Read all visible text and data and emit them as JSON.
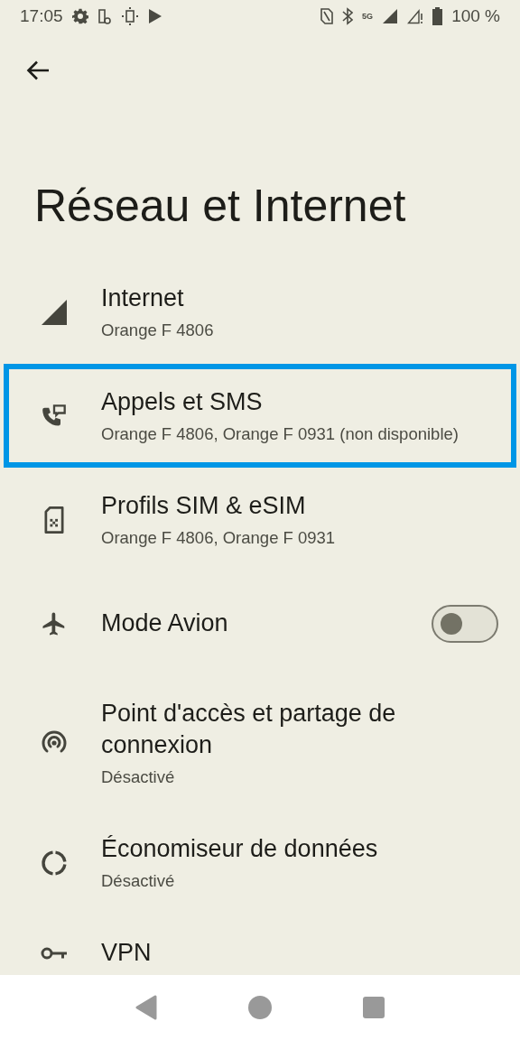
{
  "status_bar": {
    "time": "17:05",
    "network_type": "5G",
    "battery": "100 %"
  },
  "title": "Réseau et Internet",
  "items": [
    {
      "kind": "link",
      "title": "Internet",
      "subtitle": "Orange F 4806",
      "selected": false
    },
    {
      "kind": "link",
      "title": "Appels et SMS",
      "subtitle": "Orange F 4806, Orange F 0931 (non disponible)",
      "selected": true
    },
    {
      "kind": "link",
      "title": "Profils SIM & eSIM",
      "subtitle": "Orange F 4806, Orange F 0931",
      "selected": false
    },
    {
      "kind": "toggle",
      "title": "Mode Avion",
      "on": false,
      "selected": false
    },
    {
      "kind": "link",
      "title": "Point d'accès et partage de connexion",
      "subtitle": "Désactivé",
      "selected": false
    },
    {
      "kind": "link",
      "title": "Économiseur de données",
      "subtitle": "Désactivé",
      "selected": false
    },
    {
      "kind": "link",
      "title": "VPN",
      "selected": false
    }
  ]
}
